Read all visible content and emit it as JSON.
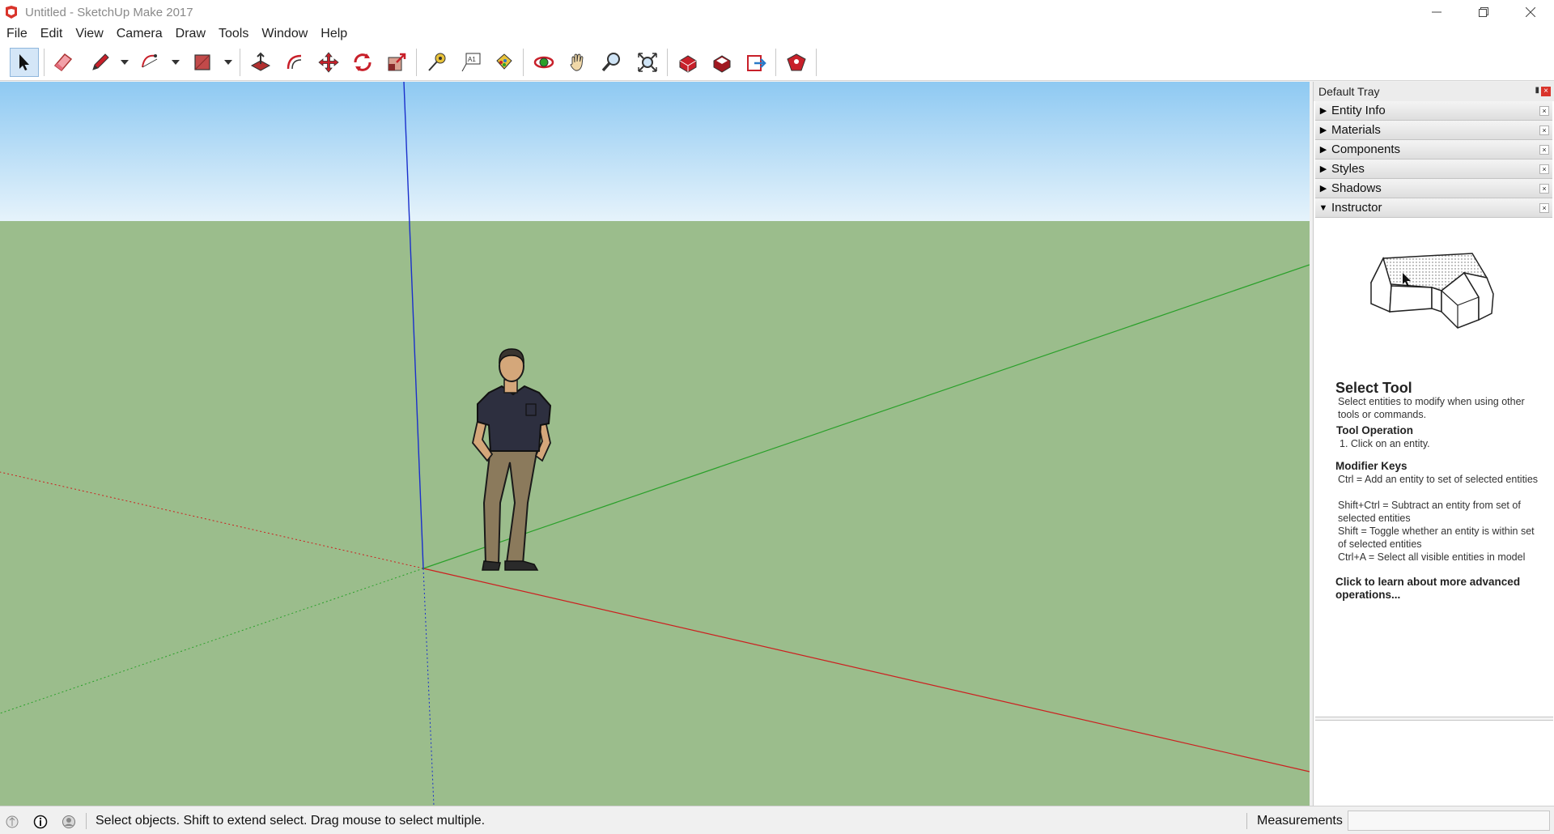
{
  "window": {
    "title": "Untitled - SketchUp Make 2017",
    "minimize_icon": "minimize-icon",
    "restore_icon": "restore-icon",
    "close_icon": "close-icon"
  },
  "menu": [
    "File",
    "Edit",
    "View",
    "Camera",
    "Draw",
    "Tools",
    "Window",
    "Help"
  ],
  "toolbar": {
    "tools": [
      "select",
      "eraser",
      "line",
      "arc",
      "rectangle",
      "push-pull",
      "offset",
      "move",
      "rotate",
      "scale",
      "tape-measure",
      "text",
      "paint-bucket",
      "orbit",
      "pan",
      "zoom",
      "zoom-extents",
      "3d-warehouse",
      "extension-warehouse",
      "layout",
      "extension-manager"
    ],
    "active_tool": "select"
  },
  "viewport": {
    "colors": {
      "sky": "#8ec9f2",
      "ground": "#9bbd8c",
      "red_axis": "#cc1f1f",
      "green_axis": "#2aa02a",
      "blue_axis": "#1a2fcc"
    }
  },
  "tray": {
    "title": "Default Tray",
    "sections": [
      {
        "label": "Entity Info",
        "expanded": false
      },
      {
        "label": "Materials",
        "expanded": false
      },
      {
        "label": "Components",
        "expanded": false
      },
      {
        "label": "Styles",
        "expanded": false
      },
      {
        "label": "Shadows",
        "expanded": false
      },
      {
        "label": "Instructor",
        "expanded": true
      }
    ],
    "instructor": {
      "heading": "Select Tool",
      "description": "Select entities to modify when using other tools or commands.",
      "op_heading": "Tool Operation",
      "op_1": "1. Click on an entity.",
      "mod_heading": "Modifier Keys",
      "mod_1": "Ctrl = Add an entity to set of selected entities",
      "mod_2": "Shift+Ctrl = Subtract an entity from set of selected entities",
      "mod_3": "Shift = Toggle whether an entity is within set of selected entities",
      "mod_4": "Ctrl+A = Select all visible entities in model",
      "link": "Click to learn about more advanced operations..."
    }
  },
  "status": {
    "message": "Select objects. Shift to extend select. Drag mouse to select multiple.",
    "measurements_label": "Measurements",
    "measurements_value": ""
  }
}
